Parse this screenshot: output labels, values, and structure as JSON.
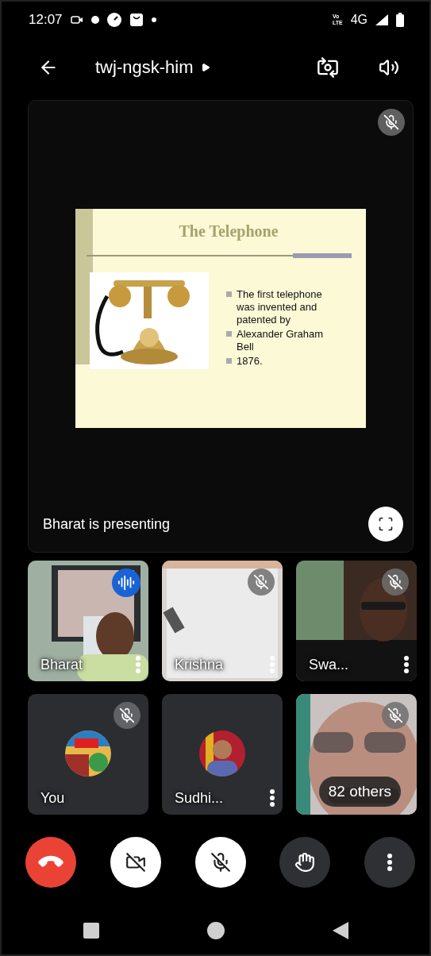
{
  "status_bar": {
    "time": "12:07",
    "volte": [
      "Vo",
      "LTE"
    ],
    "network": "4G"
  },
  "top_bar": {
    "meeting_code": "twj-ngsk-him"
  },
  "stage": {
    "muted": true,
    "presenter_label": "Bharat is presenting",
    "slide": {
      "title": "The Telephone",
      "bullets": [
        {
          "text": "The first telephone was invented and patented by"
        },
        {
          "text": "Alexander Graham Bell"
        },
        {
          "text": "1876."
        }
      ]
    }
  },
  "tiles": [
    {
      "name": "Bharat",
      "kind": "video",
      "muted": false,
      "speaking": true,
      "menu": true
    },
    {
      "name": "Krishna",
      "kind": "video",
      "muted": true,
      "speaking": false,
      "menu": true
    },
    {
      "name": "Swa...",
      "kind": "video",
      "muted": true,
      "speaking": false,
      "menu": true
    },
    {
      "name": "You",
      "kind": "avatar",
      "muted": true,
      "speaking": false,
      "menu": false
    },
    {
      "name": "Sudhi...",
      "kind": "avatar",
      "muted": false,
      "speaking": false,
      "menu": true
    },
    {
      "kind": "overflow",
      "muted": true,
      "speaking": false,
      "menu": false,
      "others": "82 others"
    }
  ],
  "controls": {
    "camera_on": false,
    "mic_on": false
  }
}
